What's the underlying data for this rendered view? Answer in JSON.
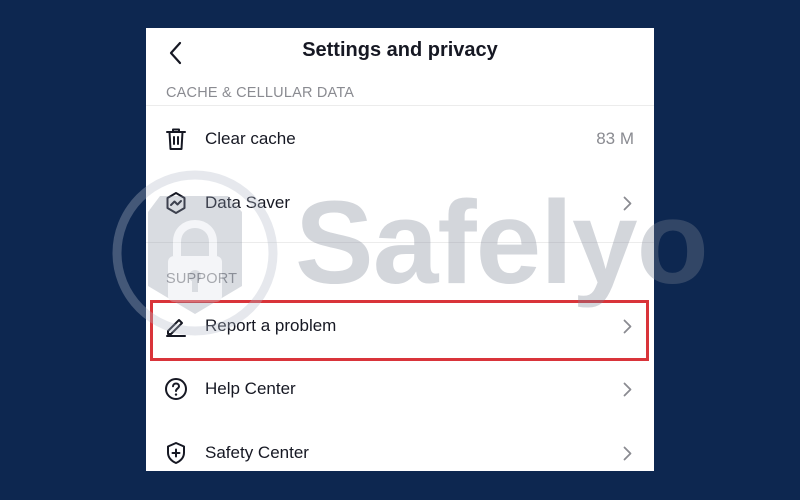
{
  "header": {
    "title": "Settings and privacy",
    "back_icon": "chevron-left-icon"
  },
  "sections": {
    "cache": {
      "label": "CACHE & CELLULAR DATA",
      "items": [
        {
          "label": "Clear cache",
          "value": "83 M",
          "icon": "trash-icon"
        },
        {
          "label": "Data Saver",
          "icon": "data-saver-icon"
        }
      ]
    },
    "support": {
      "label": "SUPPORT",
      "items": [
        {
          "label": "Report a problem",
          "icon": "pencil-icon"
        },
        {
          "label": "Help Center",
          "icon": "question-circle-icon"
        },
        {
          "label": "Safety Center",
          "icon": "shield-plus-icon"
        }
      ]
    }
  },
  "watermark": {
    "text": "Safelyo"
  },
  "colors": {
    "background": "#0d2750",
    "highlight": "#d9343a",
    "text_primary": "#161823",
    "text_secondary": "#8a8b91"
  }
}
